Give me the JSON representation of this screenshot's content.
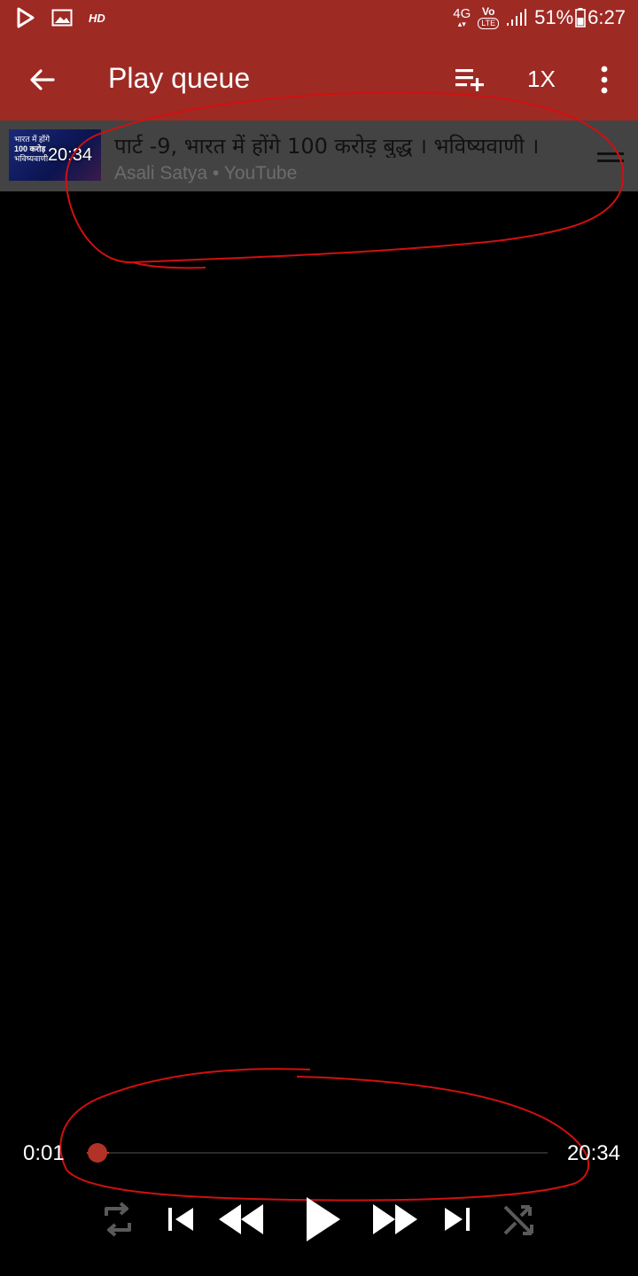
{
  "status_bar": {
    "hd": "HD",
    "network": "4G",
    "volte_top": "Vo",
    "volte_bottom": "LTE",
    "battery": "51%",
    "time": "6:27"
  },
  "app_bar": {
    "title": "Play queue",
    "speed": "1X"
  },
  "queue": {
    "items": [
      {
        "title": "पार्ट -9, भारत में होंगे 100 करोड़ बुद्ध । भविष्यवाणी ।",
        "channel": "Asali Satya",
        "separator": "•",
        "source": "YouTube",
        "duration": "20:34",
        "thumb_text_1": "भारत में होंगे",
        "thumb_text_2": "100 करोड़",
        "thumb_text_3": "भविष्यवाणी"
      }
    ]
  },
  "player": {
    "current_time": "0:01",
    "total_time": "20:34",
    "progress": 0.001
  },
  "colors": {
    "accent": "#9e2a24",
    "queue_item_bg": "#434343",
    "seek": "#b23228"
  }
}
